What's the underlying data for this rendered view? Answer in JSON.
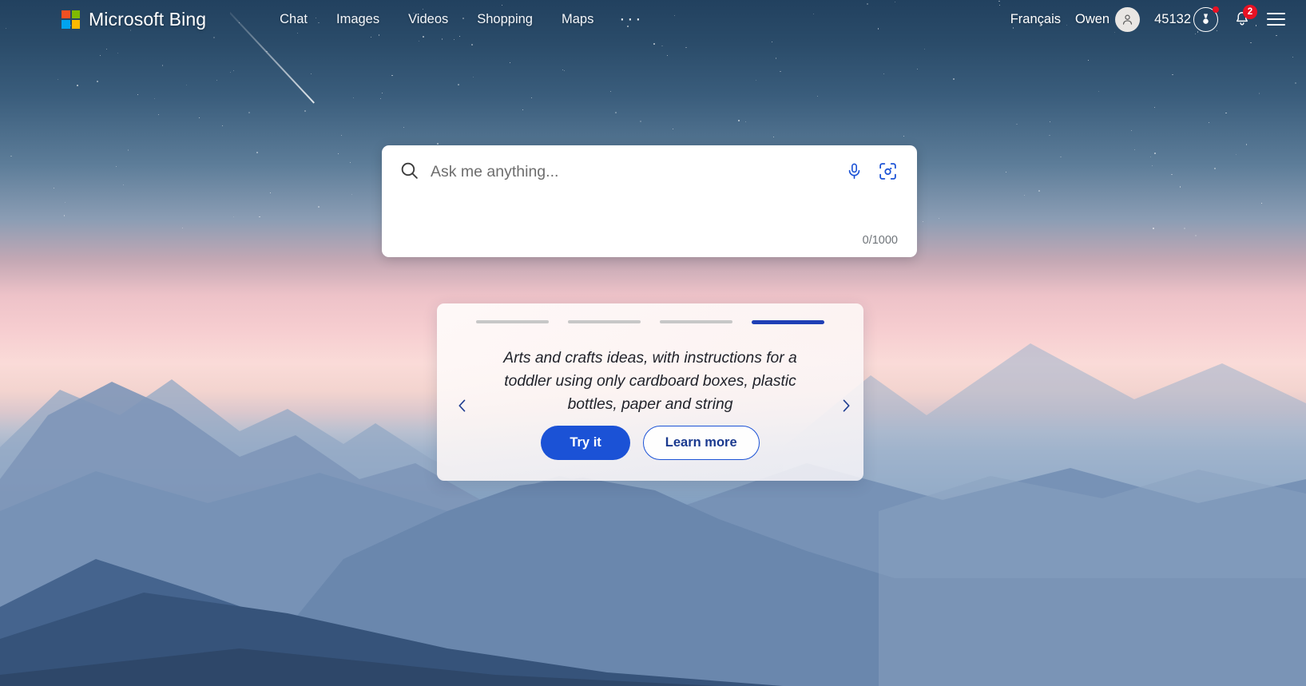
{
  "header": {
    "brand": "Microsoft Bing",
    "logo_colors": [
      "#f25022",
      "#7fba00",
      "#00a4ef",
      "#ffb900"
    ],
    "nav": [
      {
        "label": "Chat",
        "name": "nav-chat"
      },
      {
        "label": "Images",
        "name": "nav-images"
      },
      {
        "label": "Videos",
        "name": "nav-videos"
      },
      {
        "label": "Shopping",
        "name": "nav-shopping"
      },
      {
        "label": "Maps",
        "name": "nav-maps"
      }
    ],
    "more_label": "···",
    "language": "Français",
    "username": "Owen",
    "rewards_points": "45132",
    "notification_count": "2"
  },
  "search": {
    "placeholder": "Ask me anything...",
    "value": "",
    "counter": "0/1000"
  },
  "carousel": {
    "indicator_count": 4,
    "active_index": 3,
    "text": "Arts and crafts ideas, with instructions for a toddler using only cardboard boxes, plastic bottles, paper and string",
    "primary_button": "Try it",
    "secondary_button": "Learn more",
    "prev_label": "‹",
    "next_label": "›"
  },
  "theme": {
    "accent_blue": "#1b52d6",
    "active_bar": "#1f3fb5",
    "badge_red": "#e81123",
    "inactive_bar": "#c7c7c7"
  }
}
